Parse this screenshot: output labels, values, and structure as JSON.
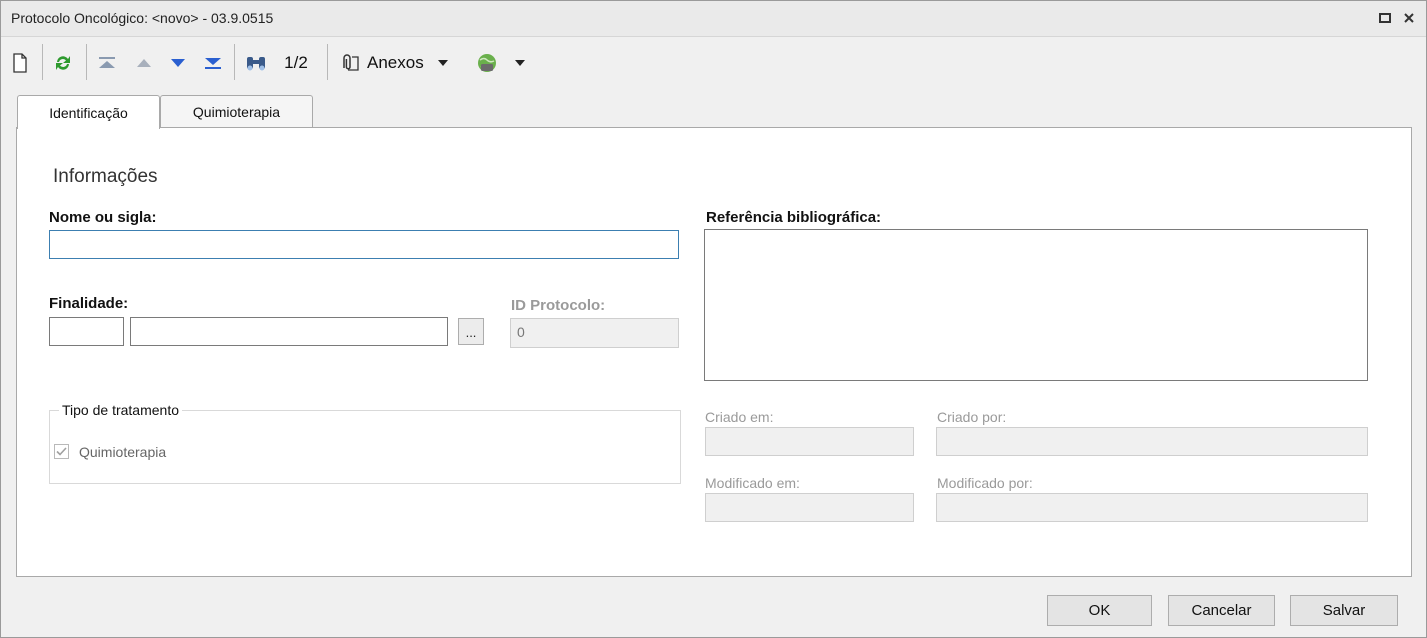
{
  "window": {
    "title": "Protocolo Oncológico: <novo> - 03.9.0515"
  },
  "toolbar": {
    "record_position": "1/2",
    "attachments_label": "Anexos"
  },
  "tabs": [
    {
      "label": "Identificação",
      "active": true
    },
    {
      "label": "Quimioterapia",
      "active": false
    }
  ],
  "form": {
    "section_title": "Informações",
    "name_label": "Nome ou sigla:",
    "name_value": "",
    "purpose_label": "Finalidade:",
    "purpose_code": "",
    "purpose_desc": "",
    "lookup_label": "...",
    "id_label": "ID Protocolo:",
    "id_value": "0",
    "treatment_group_label": "Tipo de tratamento",
    "treatment_chemo_label": "Quimioterapia",
    "treatment_chemo_checked": true,
    "bibliography_label": "Referência bibliográfica:",
    "created_on_label": "Criado em:",
    "created_by_label": "Criado por:",
    "modified_on_label": "Modificado em:",
    "modified_by_label": "Modificado por:"
  },
  "footer": {
    "ok_label": "OK",
    "cancel_label": "Cancelar",
    "save_label": "Salvar"
  },
  "colors": {
    "focus_border": "#3c7fb1",
    "refresh_icon": "#2e9a2e",
    "nav_arrow_blue": "#2a5fd0"
  }
}
